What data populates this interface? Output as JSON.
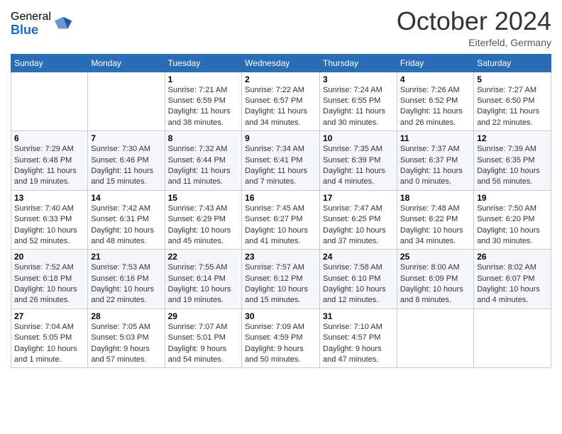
{
  "header": {
    "logo_general": "General",
    "logo_blue": "Blue",
    "month_title": "October 2024",
    "subtitle": "Eiterfeld, Germany"
  },
  "weekdays": [
    "Sunday",
    "Monday",
    "Tuesday",
    "Wednesday",
    "Thursday",
    "Friday",
    "Saturday"
  ],
  "weeks": [
    [
      {
        "day": "",
        "info": ""
      },
      {
        "day": "",
        "info": ""
      },
      {
        "day": "1",
        "info": "Sunrise: 7:21 AM\nSunset: 6:59 PM\nDaylight: 11 hours and 38 minutes."
      },
      {
        "day": "2",
        "info": "Sunrise: 7:22 AM\nSunset: 6:57 PM\nDaylight: 11 hours and 34 minutes."
      },
      {
        "day": "3",
        "info": "Sunrise: 7:24 AM\nSunset: 6:55 PM\nDaylight: 11 hours and 30 minutes."
      },
      {
        "day": "4",
        "info": "Sunrise: 7:26 AM\nSunset: 6:52 PM\nDaylight: 11 hours and 26 minutes."
      },
      {
        "day": "5",
        "info": "Sunrise: 7:27 AM\nSunset: 6:50 PM\nDaylight: 11 hours and 22 minutes."
      }
    ],
    [
      {
        "day": "6",
        "info": "Sunrise: 7:29 AM\nSunset: 6:48 PM\nDaylight: 11 hours and 19 minutes."
      },
      {
        "day": "7",
        "info": "Sunrise: 7:30 AM\nSunset: 6:46 PM\nDaylight: 11 hours and 15 minutes."
      },
      {
        "day": "8",
        "info": "Sunrise: 7:32 AM\nSunset: 6:44 PM\nDaylight: 11 hours and 11 minutes."
      },
      {
        "day": "9",
        "info": "Sunrise: 7:34 AM\nSunset: 6:41 PM\nDaylight: 11 hours and 7 minutes."
      },
      {
        "day": "10",
        "info": "Sunrise: 7:35 AM\nSunset: 6:39 PM\nDaylight: 11 hours and 4 minutes."
      },
      {
        "day": "11",
        "info": "Sunrise: 7:37 AM\nSunset: 6:37 PM\nDaylight: 11 hours and 0 minutes."
      },
      {
        "day": "12",
        "info": "Sunrise: 7:39 AM\nSunset: 6:35 PM\nDaylight: 10 hours and 56 minutes."
      }
    ],
    [
      {
        "day": "13",
        "info": "Sunrise: 7:40 AM\nSunset: 6:33 PM\nDaylight: 10 hours and 52 minutes."
      },
      {
        "day": "14",
        "info": "Sunrise: 7:42 AM\nSunset: 6:31 PM\nDaylight: 10 hours and 48 minutes."
      },
      {
        "day": "15",
        "info": "Sunrise: 7:43 AM\nSunset: 6:29 PM\nDaylight: 10 hours and 45 minutes."
      },
      {
        "day": "16",
        "info": "Sunrise: 7:45 AM\nSunset: 6:27 PM\nDaylight: 10 hours and 41 minutes."
      },
      {
        "day": "17",
        "info": "Sunrise: 7:47 AM\nSunset: 6:25 PM\nDaylight: 10 hours and 37 minutes."
      },
      {
        "day": "18",
        "info": "Sunrise: 7:48 AM\nSunset: 6:22 PM\nDaylight: 10 hours and 34 minutes."
      },
      {
        "day": "19",
        "info": "Sunrise: 7:50 AM\nSunset: 6:20 PM\nDaylight: 10 hours and 30 minutes."
      }
    ],
    [
      {
        "day": "20",
        "info": "Sunrise: 7:52 AM\nSunset: 6:18 PM\nDaylight: 10 hours and 26 minutes."
      },
      {
        "day": "21",
        "info": "Sunrise: 7:53 AM\nSunset: 6:16 PM\nDaylight: 10 hours and 22 minutes."
      },
      {
        "day": "22",
        "info": "Sunrise: 7:55 AM\nSunset: 6:14 PM\nDaylight: 10 hours and 19 minutes."
      },
      {
        "day": "23",
        "info": "Sunrise: 7:57 AM\nSunset: 6:12 PM\nDaylight: 10 hours and 15 minutes."
      },
      {
        "day": "24",
        "info": "Sunrise: 7:58 AM\nSunset: 6:10 PM\nDaylight: 10 hours and 12 minutes."
      },
      {
        "day": "25",
        "info": "Sunrise: 8:00 AM\nSunset: 6:09 PM\nDaylight: 10 hours and 8 minutes."
      },
      {
        "day": "26",
        "info": "Sunrise: 8:02 AM\nSunset: 6:07 PM\nDaylight: 10 hours and 4 minutes."
      }
    ],
    [
      {
        "day": "27",
        "info": "Sunrise: 7:04 AM\nSunset: 5:05 PM\nDaylight: 10 hours and 1 minute."
      },
      {
        "day": "28",
        "info": "Sunrise: 7:05 AM\nSunset: 5:03 PM\nDaylight: 9 hours and 57 minutes."
      },
      {
        "day": "29",
        "info": "Sunrise: 7:07 AM\nSunset: 5:01 PM\nDaylight: 9 hours and 54 minutes."
      },
      {
        "day": "30",
        "info": "Sunrise: 7:09 AM\nSunset: 4:59 PM\nDaylight: 9 hours and 50 minutes."
      },
      {
        "day": "31",
        "info": "Sunrise: 7:10 AM\nSunset: 4:57 PM\nDaylight: 9 hours and 47 minutes."
      },
      {
        "day": "",
        "info": ""
      },
      {
        "day": "",
        "info": ""
      }
    ]
  ]
}
